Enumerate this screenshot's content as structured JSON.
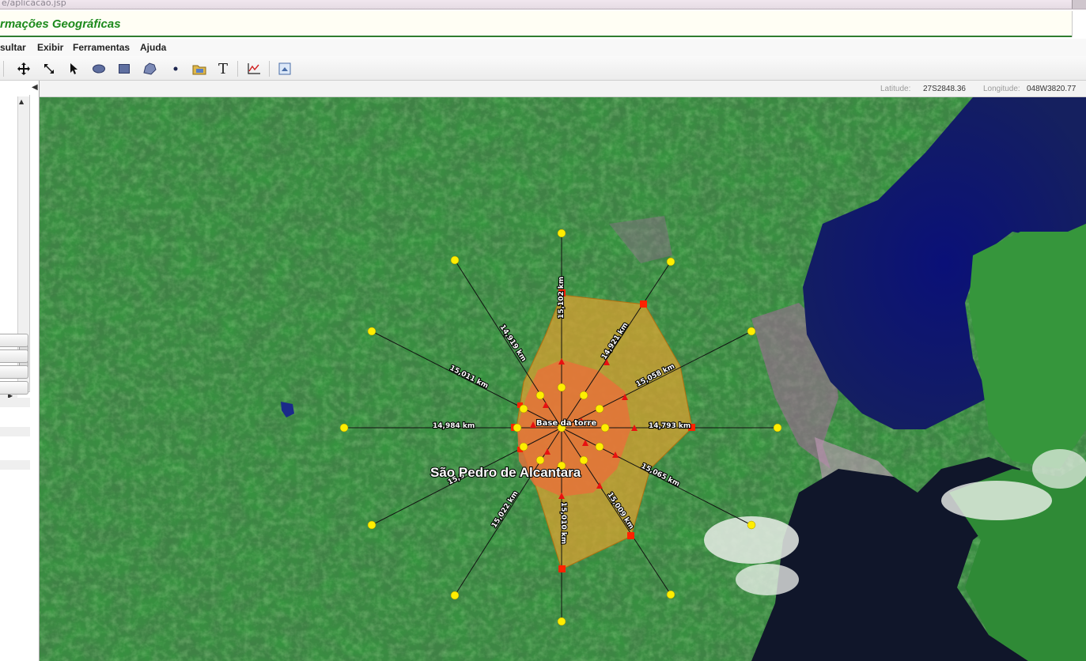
{
  "browser": {
    "url_fragment": "e/aplicacao.jsp"
  },
  "app": {
    "title": "rmações Geográficas"
  },
  "menu": [
    "sultar",
    "Exibir",
    "Ferramentas",
    "Ajuda"
  ],
  "toolbar": {
    "icons": [
      "move-icon",
      "resize-arrow-icon",
      "select-pointer-icon",
      "ellipse-icon",
      "rectangle-icon",
      "polygon-icon",
      "point-icon",
      "layer-folder-icon",
      "text-tool-icon",
      "profile-chart-icon",
      "export-image-icon"
    ],
    "text_tool_label": "T"
  },
  "status": {
    "latitude_label": "Latitude:",
    "latitude_value": "27S2848.36",
    "longitude_label": "Longitude:",
    "longitude_value": "048W3820.77"
  },
  "map": {
    "city_label": "São Pedro de Alcantara",
    "center_label": "Base da torre",
    "radial_distances": [
      {
        "direction": "N",
        "label": "15,102 km"
      },
      {
        "direction": "NNE",
        "label": "14,921 km"
      },
      {
        "direction": "ENE",
        "label": "15,058 km"
      },
      {
        "direction": "E",
        "label": "14,793 km"
      },
      {
        "direction": "ESE",
        "label": "15,065 km"
      },
      {
        "direction": "SSE",
        "label": "15,009 km"
      },
      {
        "direction": "S",
        "label": "15,010 km"
      },
      {
        "direction": "SSW",
        "label": "15,022 km"
      },
      {
        "direction": "WSW",
        "label": "15,0"
      },
      {
        "direction": "W",
        "label": "14,984 km"
      },
      {
        "direction": "WNW",
        "label": "15,011 km"
      },
      {
        "direction": "NNW",
        "label": "14,919 km"
      }
    ],
    "colors": {
      "coverage_fill": "#d9a030",
      "inner_fill": "#e8703a",
      "marker_yellow": "#ffee00",
      "marker_red": "#ff2200",
      "water": "#101a6e"
    }
  }
}
